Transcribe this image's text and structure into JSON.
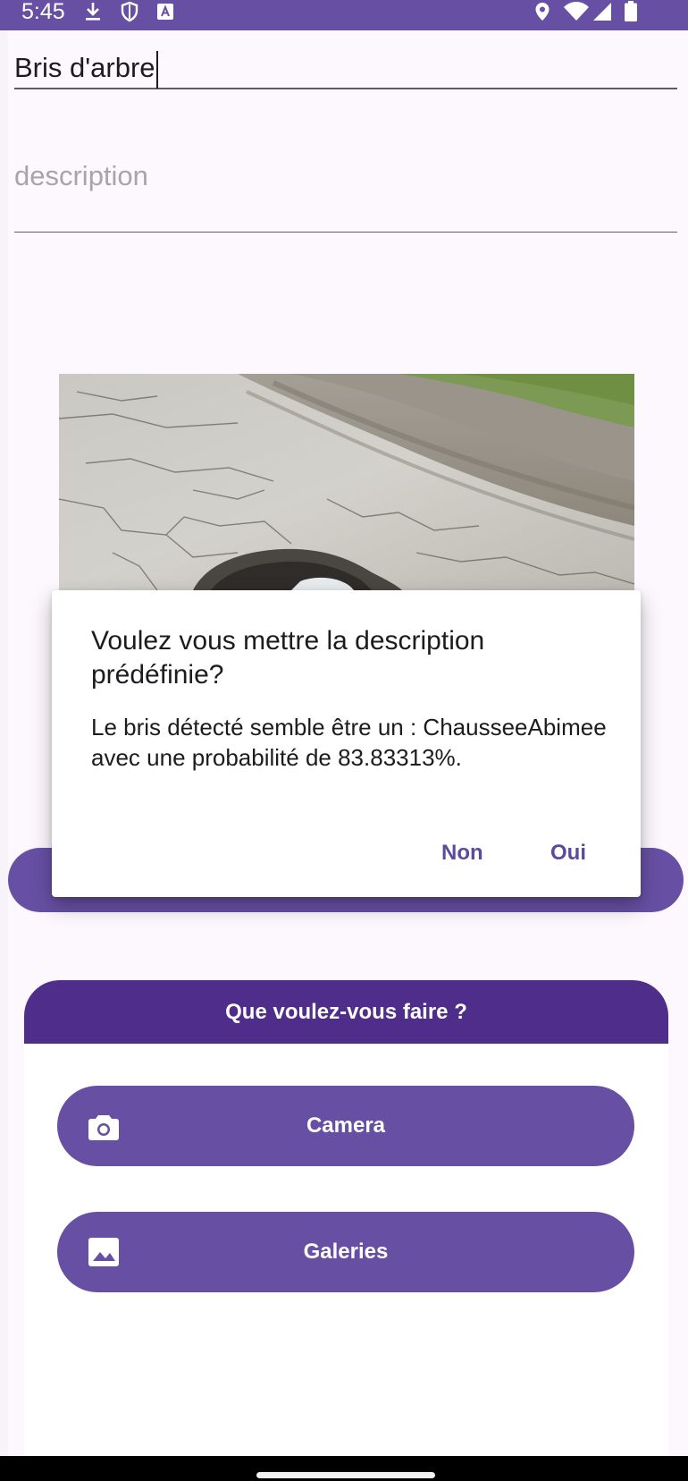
{
  "status_bar": {
    "time": "5:45",
    "left_icons": [
      "download-icon",
      "shield-icon",
      "font-a-icon"
    ],
    "right_icons": [
      "location-icon",
      "wifi-icon",
      "signal-icon",
      "battery-icon"
    ],
    "color": "#6750a4"
  },
  "form": {
    "title_value": "Bris d'arbre",
    "description_placeholder": "description"
  },
  "photo": {
    "subject": "road-pothole-photo"
  },
  "dialog": {
    "title": "Voulez vous mettre la description prédéfinie?",
    "message": "Le bris détecté semble être un : ChausseeAbimee avec une probabilité de 83.83313%.",
    "negative_label": "Non",
    "positive_label": "Oui"
  },
  "sheet": {
    "header": "Que voulez-vous faire ?",
    "buttons": [
      {
        "label": "Camera",
        "icon": "camera-icon"
      },
      {
        "label": "Galeries",
        "icon": "image-icon"
      }
    ],
    "header_color": "#4f2d8a",
    "button_color": "#6750a4"
  }
}
